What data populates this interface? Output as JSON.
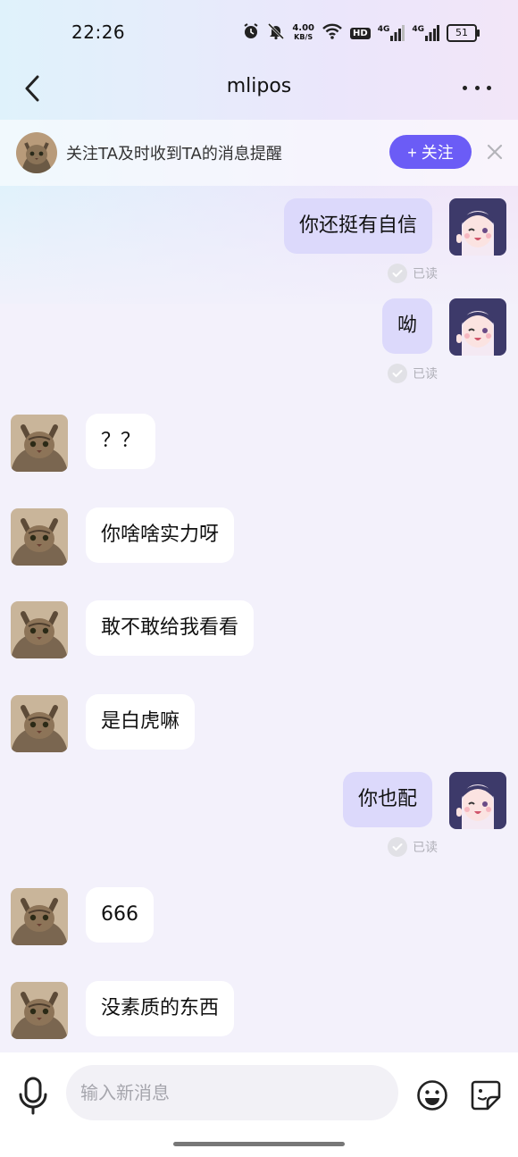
{
  "status_bar": {
    "time": "22:26",
    "net_speed_value": "4.00",
    "net_speed_unit": "KB/S",
    "hd_label": "HD",
    "signal1_label": "4G",
    "signal2_label": "4G",
    "battery": "51",
    "icons": [
      "alarm-icon",
      "mute-bell-icon",
      "wifi-icon",
      "hd-icon",
      "signal-icon",
      "signal-icon",
      "battery-icon"
    ]
  },
  "header": {
    "title": "mlipos",
    "back_icon": "chevron-left-icon",
    "more_icon": "more-horizontal-icon"
  },
  "follow_bar": {
    "text": "关注TA及时收到TA的消息提醒",
    "button_label": "+ 关注",
    "accent": "#6b5cf6"
  },
  "read_label": "已读",
  "messages": [
    {
      "side": "right",
      "text": "你还挺有自信",
      "read": true
    },
    {
      "side": "right",
      "text": "呦",
      "read": true
    },
    {
      "side": "left",
      "text": "？？"
    },
    {
      "side": "left",
      "text": "你啥啥实力呀"
    },
    {
      "side": "left",
      "text": "敢不敢给我看看"
    },
    {
      "side": "left",
      "text": "是白虎嘛"
    },
    {
      "side": "right",
      "text": "你也配",
      "read": true
    },
    {
      "side": "left",
      "text": "666"
    },
    {
      "side": "left",
      "text": "没素质的东西"
    }
  ],
  "input": {
    "placeholder": "输入新消息"
  },
  "colors": {
    "bubble_self": "#dcd9fb",
    "bubble_other": "#ffffff",
    "background": "#f3f1fb"
  }
}
